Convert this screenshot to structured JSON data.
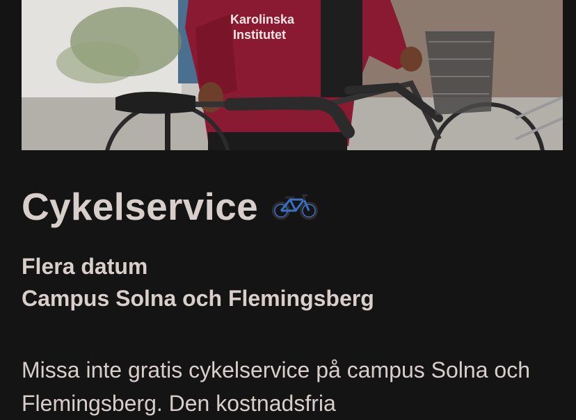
{
  "hero": {
    "image_alt": "Person i Karolinska Institutet-tröja håller i en cykel",
    "hoodie_text_line1": "Karolinska",
    "hoodie_text_line2": "Institutet"
  },
  "event": {
    "title": "Cykelservice",
    "title_icon": "bicycle-emoji",
    "date_line": "Flera datum",
    "location_line": "Campus Solna och Flemingsberg",
    "description": "Missa inte gratis cykelservice på campus Solna och Flemingsberg. Den kostnadsfria"
  },
  "colors": {
    "background": "#141414",
    "text": "#d8cfcc",
    "hoodie": "#8a1a32",
    "bike_icon": "#3a6fc4"
  }
}
